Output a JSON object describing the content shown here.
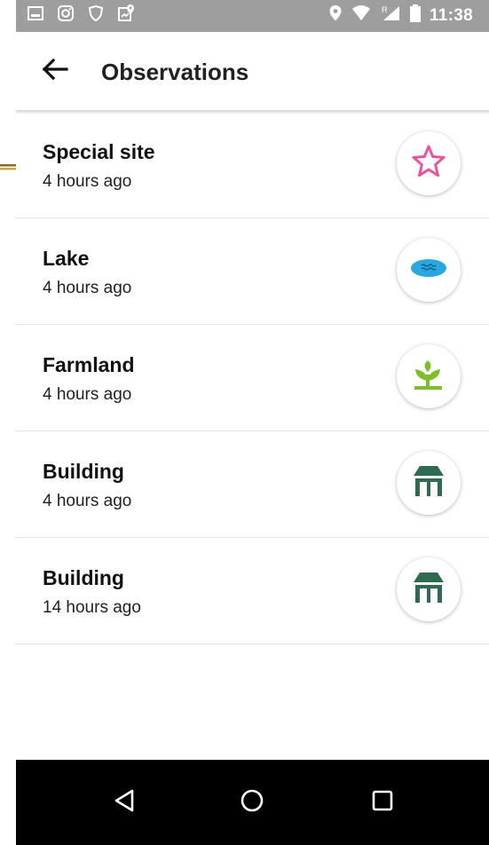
{
  "status_bar": {
    "time": "11:38",
    "left_icons": [
      "image-icon",
      "instagram-icon",
      "shield-icon",
      "map-pin-badge-icon"
    ],
    "right_icons": [
      "location-pin-icon",
      "wifi-icon",
      "signal-icon",
      "battery-icon"
    ]
  },
  "app_bar": {
    "title": "Observations",
    "back_icon": "arrow-left-icon"
  },
  "observations": [
    {
      "title": "Special site",
      "time": "4 hours ago",
      "icon": "star-icon",
      "icon_color": "#e8559b"
    },
    {
      "title": "Lake",
      "time": "4 hours ago",
      "icon": "lake-icon",
      "icon_color": "#29a8e0"
    },
    {
      "title": "Farmland",
      "time": "4 hours ago",
      "icon": "plant-icon",
      "icon_color": "#7cbf2a"
    },
    {
      "title": "Building",
      "time": "4 hours ago",
      "icon": "building-icon",
      "icon_color": "#2e6b4f"
    },
    {
      "title": "Building",
      "time": "14 hours ago",
      "icon": "building-icon",
      "icon_color": "#2e6b4f"
    }
  ],
  "nav_bar": {
    "buttons": [
      "back-triangle-icon",
      "home-circle-icon",
      "recents-square-icon"
    ]
  },
  "colors": {
    "status_bar": "#9e9e9e",
    "nav_bar": "#000000",
    "divider": "#e4e4e4",
    "text": "#111111"
  }
}
